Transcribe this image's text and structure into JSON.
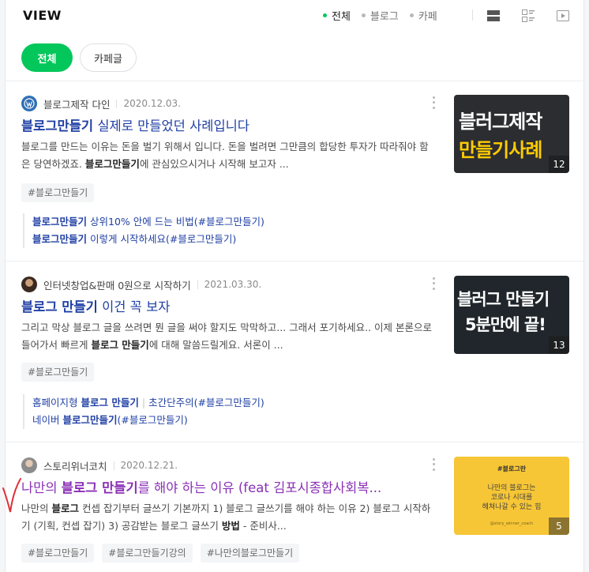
{
  "header": {
    "title": "VIEW",
    "tabs": [
      {
        "label": "전체",
        "active": true
      },
      {
        "label": "블로그",
        "active": false
      },
      {
        "label": "카페",
        "active": false
      }
    ],
    "view_icons": [
      "list-view-icon",
      "card-view-icon",
      "video-view-icon"
    ]
  },
  "filters": {
    "chips": [
      {
        "label": "전체",
        "active": true
      },
      {
        "label": "카페글",
        "active": false
      }
    ]
  },
  "results": [
    {
      "author": "블로그제작 다인",
      "date": "2020.12.03.",
      "title_bold": "블로그만들기",
      "title_rest": " 실제로 만들었던 사례입니다",
      "desc_1": "블로그를 만드는 이유는 돈을 벌기 위해서 입니다. 돈을 벌려면 그만큼의 합당한 투자가 따라줘야 함은 당연하겠죠. ",
      "desc_bold": "블로그만들기",
      "desc_2": "에 관심있으시거나 시작해 보고자 ...",
      "tags": [
        "#블로그만들기"
      ],
      "related": [
        {
          "bold": "블로그만들기",
          "rest": " 상위10% 안에 드는 비법(#블로그만들기)"
        },
        {
          "bold": "블로그만들기",
          "rest": " 이렇게 시작하세요(#블로그만들기)"
        }
      ],
      "thumb": {
        "line1": "블러그제작",
        "line2": "만들기사례",
        "count": "12"
      }
    },
    {
      "author": "인터넷창업&판매 0원으로 시작하기",
      "date": "2021.03.30.",
      "title_bold": "블로그 만들기",
      "title_rest": " 이건 꼭 보자",
      "desc_1": "그리고 막상 블로그 글을 쓰려면 뭔 글을 써야 할지도 막막하고... 그래서 포기하세요.. 이제 본론으로 들어가서 빠르게 ",
      "desc_bold": "블로그 만들기",
      "desc_2": "에 대해 말씀드릴게요. 서론이 ...",
      "tags": [
        "#블로그만들기"
      ],
      "related_line1": {
        "pre": "홈페이지형 ",
        "bold": "블로그 만들기",
        "sep": "|",
        "rest": "초간단주의(#블로그만들기)"
      },
      "related_line2": {
        "pre": "네이버 ",
        "bold": "블로그만들기",
        "rest": "(#블로그만들기)"
      },
      "thumb": {
        "line1": "블러그 만들기",
        "line2": "5분만에 끝!",
        "count": "13"
      }
    },
    {
      "author": "스토리위너코치",
      "date": "2020.12.21.",
      "title_pre": "나만의 ",
      "title_bold": "블로그 만들기",
      "title_rest": "를 해야 하는 이유 (feat 김포시종합사회복...",
      "desc_1": "나만의 ",
      "desc_bold": "블로그",
      "desc_2": " 컨셉 잡기부터 글쓰기 기본까지 1) 블로그 글쓰기를 해야 하는 이유 2) 블로그 시작하기 (기획, 컨셉 잡기) 3) 공감받는 블로그 글쓰기 ",
      "desc_bold2": "방법",
      "desc_3": " - 준비사...",
      "tags": [
        "#블로그만들기",
        "#블로그만들기강의",
        "#나만의블로그만들기"
      ],
      "thumb": {
        "line0": "#블로그란",
        "line1": "나만의 블로그는",
        "line2": "코로나 시대를",
        "line3": "헤쳐나갈 수 있는 힘",
        "line4": "@story_winner_coach",
        "count": "5"
      }
    }
  ],
  "colors": {
    "accent": "#03c75a",
    "link": "#1f3fa4",
    "visited": "#8a2fb5",
    "check_mark": "#e0303a"
  }
}
